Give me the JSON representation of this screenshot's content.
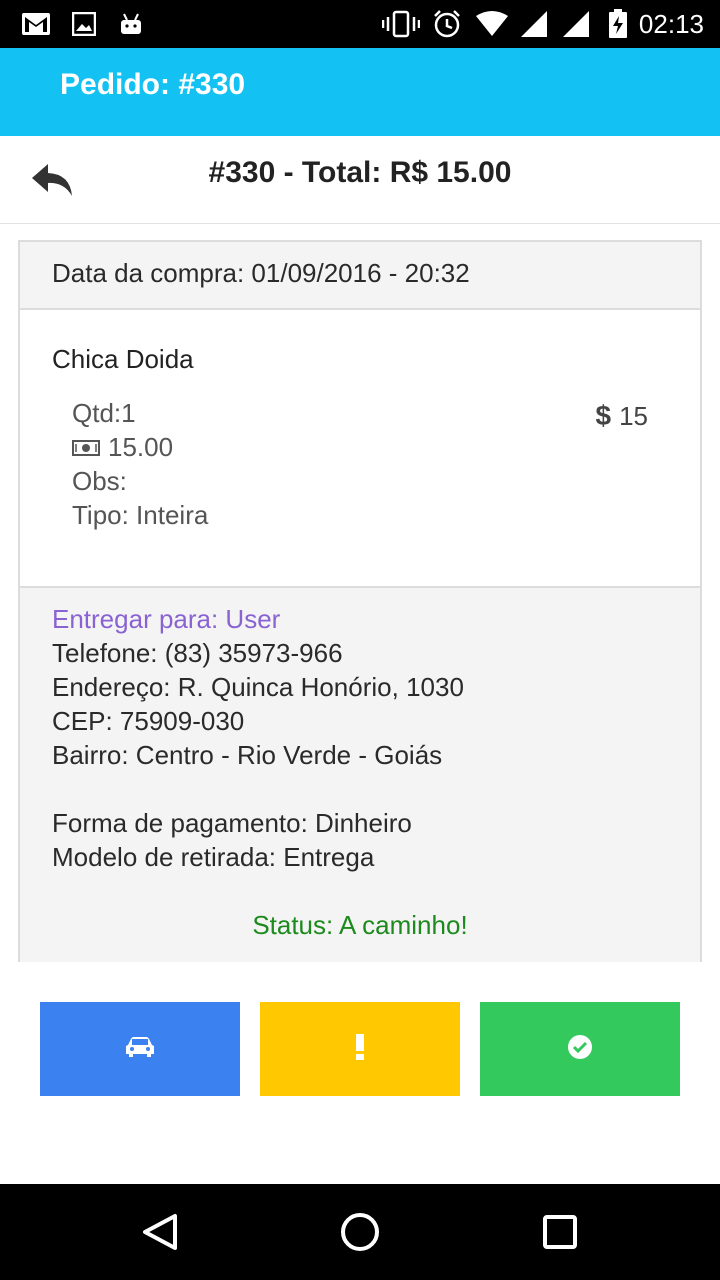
{
  "status_bar": {
    "time": "02:13",
    "icons": [
      "gmail-icon",
      "image-icon",
      "android-icon",
      "vibrate-icon",
      "alarm-icon",
      "wifi-icon",
      "signal-icon",
      "battery-charging-icon"
    ]
  },
  "app_bar": {
    "title": "Pedido: #330"
  },
  "header": {
    "title": "#330 - Total: R$ 15.00",
    "back_icon": "reply-icon"
  },
  "order": {
    "purchase_date": "Data da compra: 01/09/2016 - 20:32",
    "item": {
      "name": "Chica Doida",
      "quantity": "Qtd:1",
      "unit_price": "15.00",
      "obs": "Obs:",
      "type": "Tipo: Inteira",
      "price": "15",
      "price_symbol": "$"
    },
    "delivery": {
      "recipient": "Entregar para: User",
      "phone": "Telefone: (83) 35973-966",
      "address": "Endereço: R. Quinca Honório, 1030",
      "cep": "CEP: 75909-030",
      "district": "Bairro: Centro - Rio Verde - Goiás",
      "payment": "Forma de pagamento: Dinheiro",
      "pickup": "Modelo de retirada: Entrega",
      "status": "Status: A caminho!"
    }
  },
  "actions": [
    {
      "icon": "car-icon",
      "color": "#3b82f0"
    },
    {
      "icon": "exclamation-icon",
      "color": "#ffc800"
    },
    {
      "icon": "check-circle-icon",
      "color": "#33c95c"
    }
  ],
  "nav": [
    "back-triangle-icon",
    "home-circle-icon",
    "recents-square-icon"
  ],
  "colors": {
    "app_bar": "#13c2f2",
    "recipient": "#8a63d2",
    "status": "#1c8a1c"
  }
}
